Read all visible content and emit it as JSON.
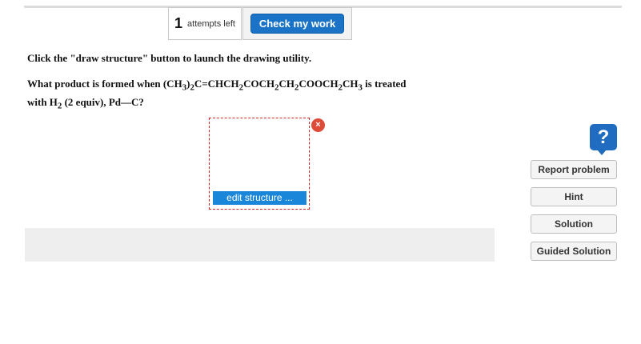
{
  "toolbar": {
    "attempts_count": "1",
    "attempts_text": "attempts left",
    "check_label": "Check my work"
  },
  "content": {
    "instruction": "Click the \"draw structure\" button to launch the drawing utility.",
    "question_line1": "What product is formed when (CH3)2C=CHCH2COCH2CH2COOCH2CH3 is treated",
    "question_line2": "with H2 (2 equiv), Pd—C?"
  },
  "drawing": {
    "close_symbol": "×",
    "edit_label": "edit structure ..."
  },
  "sidebar": {
    "help_symbol": "?",
    "report_label": "Report problem",
    "hint_label": "Hint",
    "solution_label": "Solution",
    "guided_label": "Guided Solution"
  },
  "colors": {
    "accent": "#1a73c7",
    "draw_border": "#cc2222",
    "close": "#dd4b39"
  }
}
